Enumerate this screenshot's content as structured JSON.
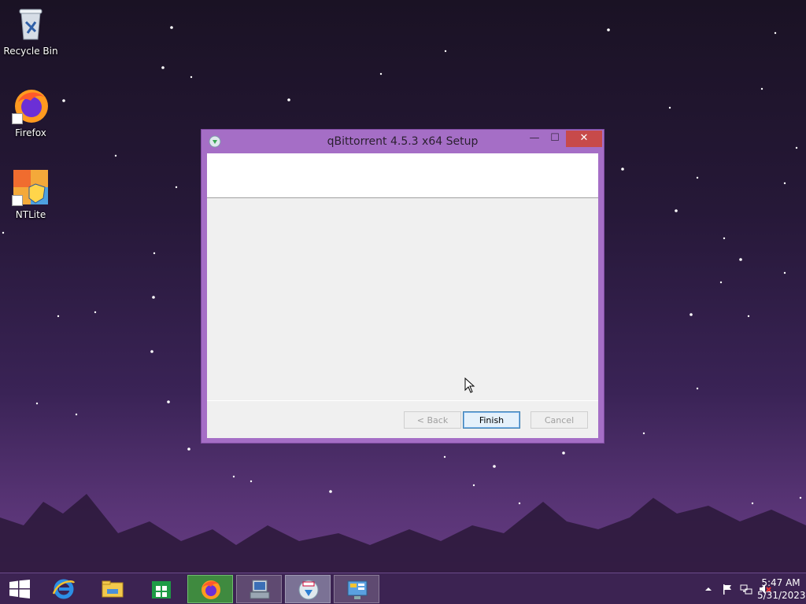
{
  "desktop": {
    "icons": [
      {
        "label": "Recycle Bin",
        "icon": "recycle-bin-icon"
      },
      {
        "label": "Firefox",
        "icon": "firefox-icon"
      },
      {
        "label": "NTLite",
        "icon": "ntlite-icon"
      }
    ]
  },
  "window": {
    "title": "qBittorrent 4.5.3 x64 Setup",
    "controls": {
      "minimize": "—",
      "maximize": "☐",
      "close": "✕"
    },
    "buttons": {
      "back": "< Back",
      "finish": "Finish",
      "cancel": "Cancel"
    },
    "back_enabled": false,
    "cancel_enabled": false,
    "default_button": "Finish"
  },
  "taskbar": {
    "apps": [
      {
        "icon": "internet-explorer-icon",
        "active": false
      },
      {
        "icon": "file-explorer-icon",
        "active": false
      },
      {
        "icon": "store-icon",
        "active": false
      },
      {
        "icon": "firefox-icon",
        "active": true
      },
      {
        "icon": "installer-icon",
        "active": true
      },
      {
        "icon": "qbittorrent-setup-icon",
        "active": true
      },
      {
        "icon": "control-panel-icon",
        "active": true
      }
    ],
    "tray": {
      "icons": [
        "show-hidden-icons-icon",
        "action-center-flag-icon",
        "network-icon",
        "volume-muted-icon"
      ],
      "time": "5:47 AM",
      "date": "5/31/2023"
    }
  },
  "colors": {
    "window_frame": "#a56ec6",
    "close_button": "#c74a4a",
    "taskbar": "#3a2250"
  }
}
